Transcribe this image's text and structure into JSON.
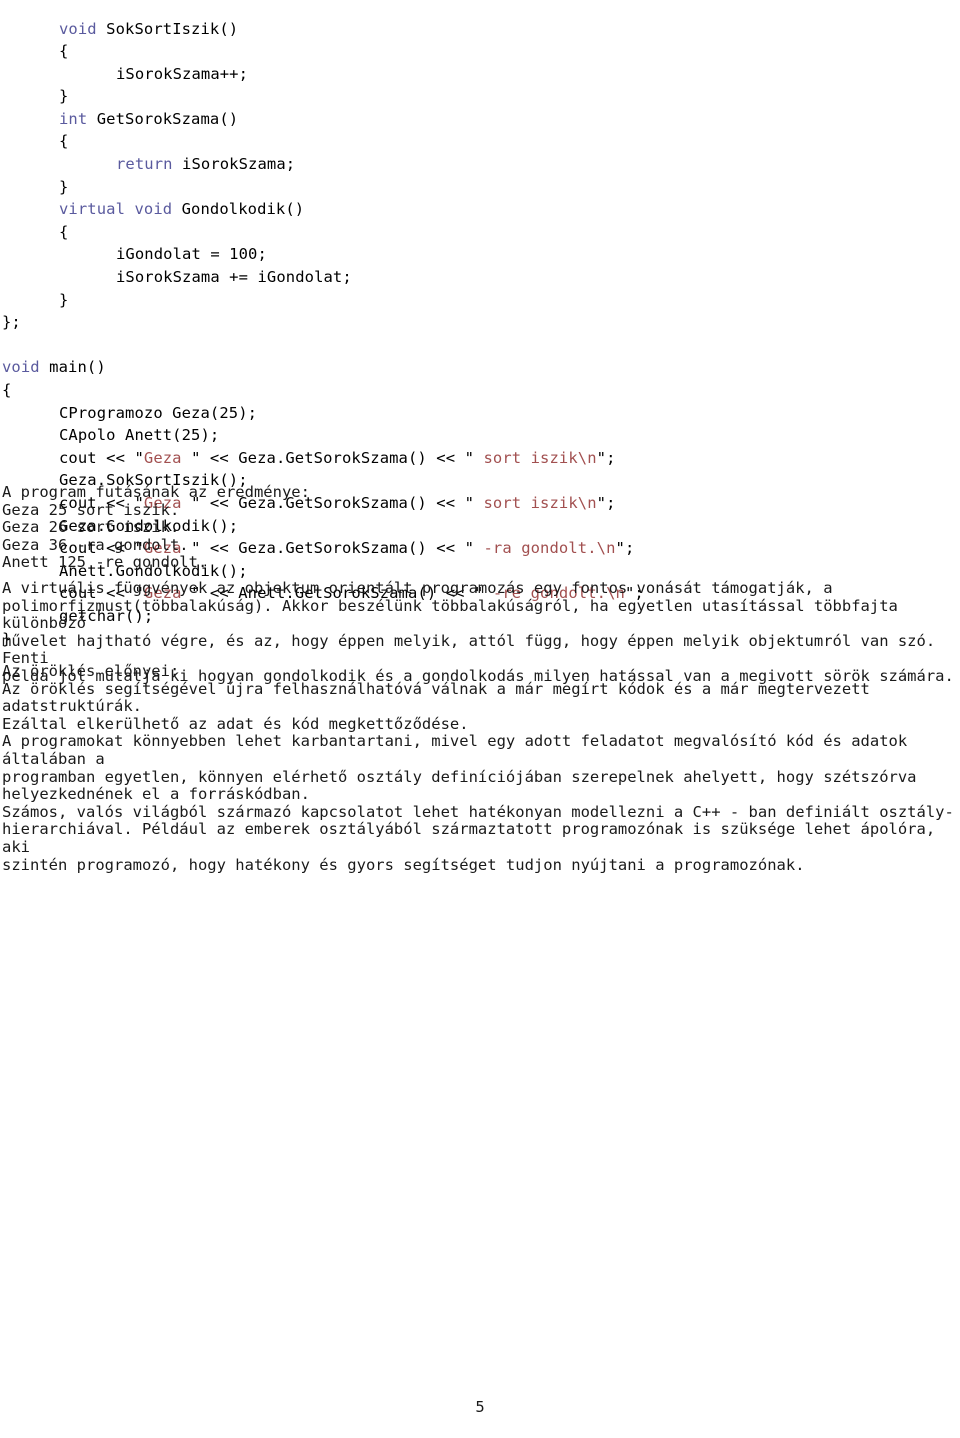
{
  "document": {
    "page_number": "5",
    "colors": {
      "keyword": "#5a5a9e",
      "string": "#a25050",
      "text": "#1a1a1a",
      "background": "#ffffff"
    }
  },
  "code": {
    "lines": [
      {
        "indent": 1,
        "tokens": [
          {
            "t": "kw",
            "v": "void"
          },
          {
            "t": "pl",
            "v": " SokSortIszik()"
          }
        ]
      },
      {
        "indent": 1,
        "tokens": [
          {
            "t": "pl",
            "v": "{"
          }
        ]
      },
      {
        "indent": 2,
        "tokens": [
          {
            "t": "pl",
            "v": "iSorokSzama++;"
          }
        ]
      },
      {
        "indent": 1,
        "tokens": [
          {
            "t": "pl",
            "v": "}"
          }
        ]
      },
      {
        "indent": 1,
        "tokens": [
          {
            "t": "kw",
            "v": "int"
          },
          {
            "t": "pl",
            "v": " GetSorokSzama()"
          }
        ]
      },
      {
        "indent": 1,
        "tokens": [
          {
            "t": "pl",
            "v": "{"
          }
        ]
      },
      {
        "indent": 2,
        "tokens": [
          {
            "t": "kw",
            "v": "return"
          },
          {
            "t": "pl",
            "v": " iSorokSzama;"
          }
        ]
      },
      {
        "indent": 1,
        "tokens": [
          {
            "t": "pl",
            "v": "}"
          }
        ]
      },
      {
        "indent": 1,
        "tokens": [
          {
            "t": "kw",
            "v": "virtual void"
          },
          {
            "t": "pl",
            "v": " Gondolkodik()"
          }
        ]
      },
      {
        "indent": 1,
        "tokens": [
          {
            "t": "pl",
            "v": "{"
          }
        ]
      },
      {
        "indent": 2,
        "tokens": [
          {
            "t": "pl",
            "v": "iGondolat = 100;"
          }
        ]
      },
      {
        "indent": 2,
        "tokens": [
          {
            "t": "pl",
            "v": "iSorokSzama += iGondolat;"
          }
        ]
      },
      {
        "indent": 1,
        "tokens": [
          {
            "t": "pl",
            "v": "}"
          }
        ]
      },
      {
        "indent": 0,
        "tokens": [
          {
            "t": "pl",
            "v": "};"
          }
        ]
      },
      {
        "indent": 0,
        "tokens": [
          {
            "t": "pl",
            "v": ""
          }
        ]
      },
      {
        "indent": 0,
        "tokens": [
          {
            "t": "kw",
            "v": "void"
          },
          {
            "t": "pl",
            "v": " main()"
          }
        ]
      },
      {
        "indent": 0,
        "tokens": [
          {
            "t": "pl",
            "v": "{"
          }
        ]
      },
      {
        "indent": 1,
        "tokens": [
          {
            "t": "pl",
            "v": "CProgramozo Geza(25);"
          }
        ]
      },
      {
        "indent": 1,
        "tokens": [
          {
            "t": "pl",
            "v": "CApolo Anett(25);"
          }
        ]
      },
      {
        "indent": 1,
        "tokens": [
          {
            "t": "pl",
            "v": "cout << \""
          },
          {
            "t": "str",
            "v": "Geza "
          },
          {
            "t": "pl",
            "v": "\" << Geza.GetSorokSzama() << \""
          },
          {
            "t": "str",
            "v": " sort iszik\\n"
          },
          {
            "t": "pl",
            "v": "\";"
          }
        ]
      },
      {
        "indent": 1,
        "tokens": [
          {
            "t": "pl",
            "v": "Geza.SokSortIszik();"
          }
        ]
      },
      {
        "indent": 1,
        "tokens": [
          {
            "t": "pl",
            "v": "cout << \""
          },
          {
            "t": "str",
            "v": "Geza "
          },
          {
            "t": "pl",
            "v": "\" << Geza.GetSorokSzama() << \""
          },
          {
            "t": "str",
            "v": " sort iszik\\n"
          },
          {
            "t": "pl",
            "v": "\";"
          }
        ]
      },
      {
        "indent": 1,
        "tokens": [
          {
            "t": "pl",
            "v": "Geza.Gondolkodik();"
          }
        ]
      },
      {
        "indent": 1,
        "tokens": [
          {
            "t": "pl",
            "v": "cout << \""
          },
          {
            "t": "str",
            "v": "Geza "
          },
          {
            "t": "pl",
            "v": "\" << Geza.GetSorokSzama() << \""
          },
          {
            "t": "str",
            "v": " -ra gondolt.\\n"
          },
          {
            "t": "pl",
            "v": "\";"
          }
        ]
      },
      {
        "indent": 1,
        "tokens": [
          {
            "t": "pl",
            "v": "Anett.Gondolkodik();"
          }
        ]
      },
      {
        "indent": 1,
        "tokens": [
          {
            "t": "pl",
            "v": "cout << \""
          },
          {
            "t": "str",
            "v": "Geza "
          },
          {
            "t": "pl",
            "v": "\" << Anett.GetSorokSzama() << \""
          },
          {
            "t": "str",
            "v": " -re gondolt.\\n"
          },
          {
            "t": "pl",
            "v": "\";"
          }
        ]
      },
      {
        "indent": 1,
        "tokens": [
          {
            "t": "pl",
            "v": "getchar();"
          }
        ]
      },
      {
        "indent": 0,
        "tokens": [
          {
            "t": "pl",
            "v": "}"
          }
        ]
      }
    ]
  },
  "output": {
    "lines": [
      "A program futásának az eredménye:",
      "Geza 25 sort iszik.",
      "Geza 26 sort iszik.",
      "Geza 36 -ra gondolt.",
      "Anett 125 -re gondolt."
    ]
  },
  "paragraph_virtual": {
    "lines": [
      "A virtuális függvények az objektum orientált programozás egy fontos vonását támogatják, a",
      "polimorfizmust(többalakúság). Akkor beszélünk többalakúságról, ha egyetlen utasítással többfajta különböző",
      "művelet hajtható végre, és az, hogy éppen melyik, attól függ, hogy éppen melyik objektumról van szó. Fenti",
      "példa jól mutatja ki hogyan gondolkodik és a gondolkodás milyen hatással van a megivott sörök számára."
    ]
  },
  "paragraph_inheritance": {
    "lines": [
      "Az öröklés előnyei:",
      "Az öröklés segítségével újra felhasználhatóvá válnak a már megírt kódok és a már megtervezett adatstruktúrák.",
      "Ezáltal elkerülhető az adat és kód megkettőződése.",
      "A programokat könnyebben lehet karbantartani, mivel egy adott feladatot megvalósító kód és adatok általában a",
      "programban egyetlen, könnyen elérhető osztály definíciójában szerepelnek ahelyett, hogy szétszórva",
      "helyezkednének el a forráskódban.",
      "Számos, valós világból származó kapcsolatot lehet hatékonyan modellezni a C++ - ban definiált osztály-",
      "hierarchiával. Például az emberek osztályából származtatott programozónak is szüksége lehet ápolóra, aki",
      "szintén programozó, hogy hatékony és gyors segítséget tudjon nyújtani a programozónak."
    ]
  }
}
